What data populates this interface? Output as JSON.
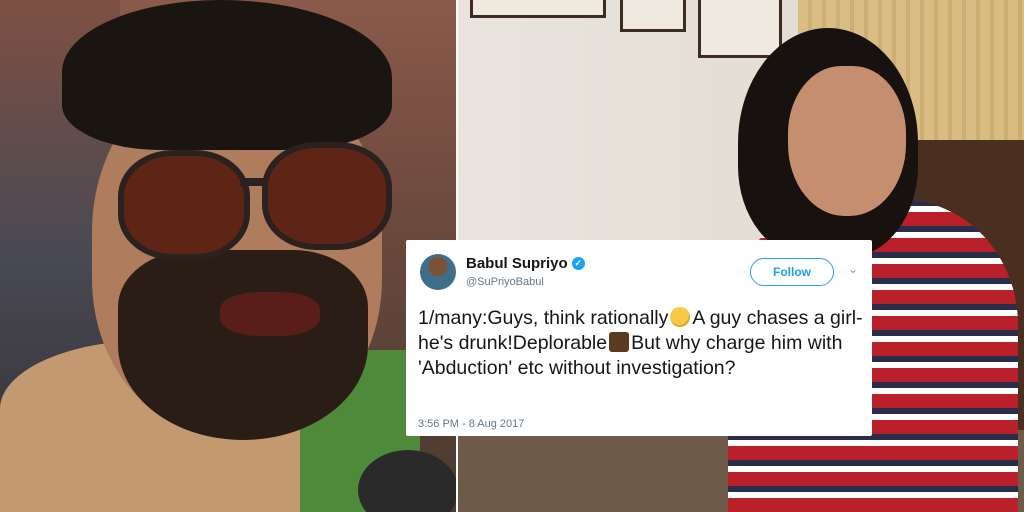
{
  "tweet": {
    "name": "Babul Supriyo",
    "handle": "@SuPriyoBabul",
    "follow_label": "Follow",
    "caret": "⌄",
    "verified_mark": "✓",
    "text_part1": "1/many:Guys, think rationally",
    "text_part2": "A guy chases a girl- he's drunk!Deplorable",
    "text_part3": "But why charge him with 'Abduction' etc without investigation?",
    "emoji_1": "thinking-face-icon",
    "emoji_2": "thumbs-down-icon",
    "timestamp": "3:56 PM - 8 Aug 2017"
  },
  "colors": {
    "twitter_blue": "#1da1f2",
    "text": "#14171a",
    "muted": "#657786"
  }
}
